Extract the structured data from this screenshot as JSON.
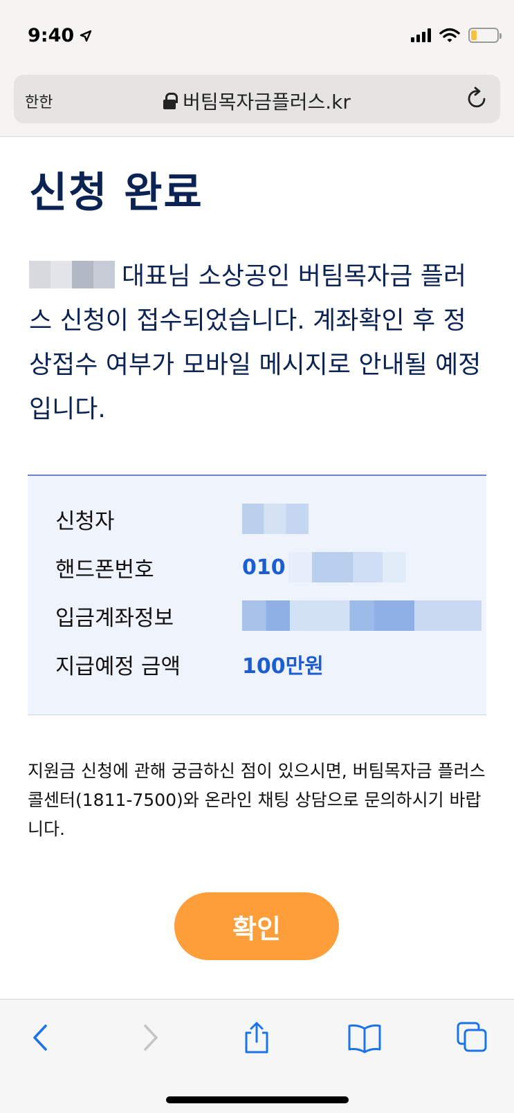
{
  "status_bar": {
    "time": "9:40"
  },
  "browser": {
    "text_size_label": "한한",
    "url": "버팀목자금플러스.kr"
  },
  "page": {
    "title": "신청 완료",
    "message": "대표님 소상공인 버팀목자금 플러스 신청이 접수되었습니다. 계좌확인 후 정상접수 여부가 모바일 메시지로 안내될 예정입니다.",
    "info": {
      "applicant_label": "신청자",
      "phone_label": "핸드폰번호",
      "phone_value_prefix": "010",
      "account_label": "입금계좌정보",
      "amount_label": "지급예정 금액",
      "amount_value": "100만원"
    },
    "help_text": "지원금 신청에 관해 궁금하신 점이 있으시면, 버팀목자금 플러스 콜센터(1811-7500)와 온라인 채팅 상담으로 문의하시기 바랍니다.",
    "confirm_label": "확인"
  },
  "colors": {
    "title": "#0b2354",
    "accent_blue": "#1c5ed2",
    "confirm_button": "#fd9e3a",
    "info_bg": "#eff3fb"
  },
  "icons": [
    "location-arrow-icon",
    "signal-icon",
    "wifi-icon",
    "battery-icon",
    "lock-icon",
    "reload-icon",
    "back-icon",
    "forward-icon",
    "share-icon",
    "bookmarks-icon",
    "tabs-icon"
  ]
}
